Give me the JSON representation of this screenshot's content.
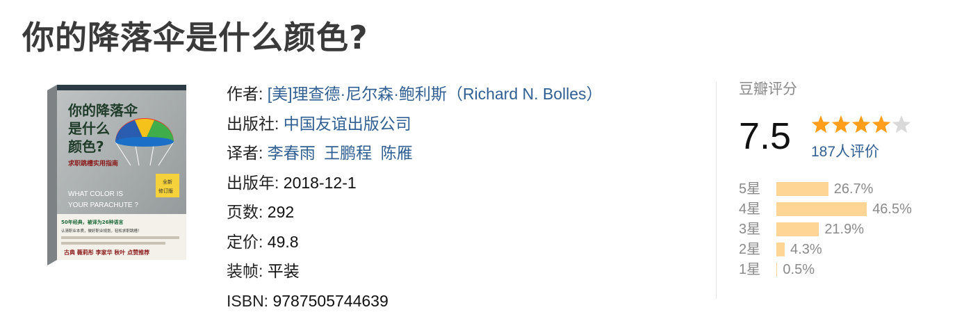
{
  "book": {
    "title": "你的降落伞是什么颜色?"
  },
  "cover": {
    "title_line1": "你的降落伞",
    "title_line2": "是什么",
    "title_line3": "颜色?",
    "subtitle": "求职跳槽实用指南",
    "english_line1": "WHAT COLOR IS",
    "english_line2": "YOUR PARACHUTE ?",
    "badge_line1": "全新",
    "badge_line2": "修订版",
    "blurb_line1": "50年经典，被译为26种语言",
    "blurb_line2": "认清职业本质，做好职业规划，轻松求职跳槽！",
    "recommenders": "古典 薇莉彤 李家华 秋叶 点赞推荐"
  },
  "info": {
    "author_label": "作者:",
    "author_value": "[美]理查德·尼尔森·鲍利斯（Richard N. Bolles）",
    "publisher_label": "出版社:",
    "publisher_value": "中国友谊出版公司",
    "translator_label": "译者:",
    "translators": [
      "李春雨",
      "王鹏程",
      "陈雁"
    ],
    "pubyear_label": "出版年:",
    "pubyear_value": "2018-12-1",
    "pages_label": "页数:",
    "pages_value": "292",
    "price_label": "定价:",
    "price_value": "49.8",
    "binding_label": "装帧:",
    "binding_value": "平装",
    "isbn_label": "ISBN:",
    "isbn_value": "9787505744639"
  },
  "rating": {
    "label": "豆瓣评分",
    "score": "7.5",
    "stars_filled": 4,
    "stars_total": 5,
    "count_text": "187人评价",
    "star_color": "#ff9e1b",
    "bar_color": "#ffd595",
    "distribution": [
      {
        "label": "5星",
        "percent_text": "26.7%",
        "percent": 26.7
      },
      {
        "label": "4星",
        "percent_text": "46.5%",
        "percent": 46.5
      },
      {
        "label": "3星",
        "percent_text": "21.9%",
        "percent": 21.9
      },
      {
        "label": "2星",
        "percent_text": "4.3%",
        "percent": 4.3
      },
      {
        "label": "1星",
        "percent_text": "0.5%",
        "percent": 0.5
      }
    ]
  }
}
